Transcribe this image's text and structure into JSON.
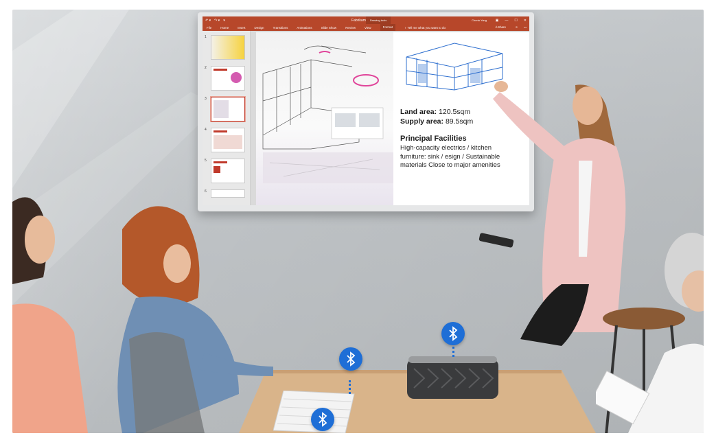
{
  "ppt": {
    "document_title": "Fabrikam Proposal",
    "drawing_tools": "Drawing tools",
    "user_name": "Cheria Yang",
    "tabs": [
      "File",
      "Home",
      "Insert",
      "Design",
      "Transitions",
      "Animations",
      "Slide Show",
      "Review",
      "View"
    ],
    "active_tab": "Format",
    "tell_me": "Tell me what you want to do",
    "share": "Share",
    "thumbnail_numbers": [
      "1",
      "2",
      "3",
      "4",
      "5",
      "6"
    ]
  },
  "slide": {
    "land_area_label": "Land area:",
    "land_area_value": " 120.5sqm",
    "supply_area_label": "Supply area:",
    "supply_area_value": " 89.5sqm",
    "facilities_title": "Principal Facilities",
    "facilities_desc": "High-capacity electrics / kitchen furniture: sink / esign / Sustainable materials Close to major amenities"
  },
  "colors": {
    "ppt_accent": "#b7472a",
    "bluetooth": "#1e6ed6"
  },
  "icons": [
    "bluetooth-icon",
    "bluetooth-icon",
    "bluetooth-icon"
  ]
}
